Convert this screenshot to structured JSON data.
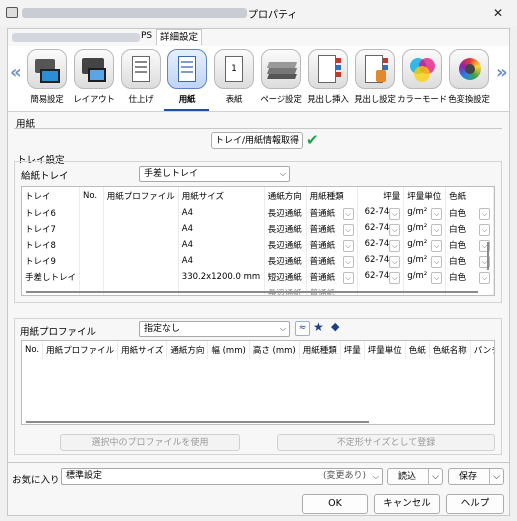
{
  "window": {
    "title": "プロパティ",
    "controls": {
      "close": "✕"
    }
  },
  "tabs": [
    {
      "label": "PS"
    },
    {
      "label": "詳細設定"
    }
  ],
  "categories": [
    {
      "label": "簡易設定"
    },
    {
      "label": "レイアウト"
    },
    {
      "label": "仕上げ"
    },
    {
      "label": "用紙",
      "selected": true
    },
    {
      "label": "表紙"
    },
    {
      "label": "ページ設定"
    },
    {
      "label": "見出し挿入"
    },
    {
      "label": "見出し設定"
    },
    {
      "label": "カラーモード"
    },
    {
      "label": "色変換設定"
    }
  ],
  "nav": {
    "prev": "«",
    "next": "»"
  },
  "paper": {
    "section_label": "用紙",
    "get_tray_info_button": "トレイ/用紙情報取得",
    "tray_settings_label": "トレイ設定",
    "feed_tray_label": "給紙トレイ",
    "feed_tray_value": "手差しトレイ"
  },
  "tray_table": {
    "headers": [
      "トレイ",
      "No.",
      "用紙プロファイル",
      "用紙サイズ",
      "通紙方向",
      "用紙種類",
      "坪量",
      "坪量単位",
      "色紙"
    ],
    "rows": [
      [
        "トレイ6",
        "",
        "",
        "A4",
        "長辺通紙",
        "普通紙",
        "62-74",
        "g/m²",
        "白色"
      ],
      [
        "トレイ7",
        "",
        "",
        "A4",
        "長辺通紙",
        "普通紙",
        "62-74",
        "g/m²",
        "白色"
      ],
      [
        "トレイ8",
        "",
        "",
        "A4",
        "長辺通紙",
        "普通紙",
        "62-74",
        "g/m²",
        "白色"
      ],
      [
        "トレイ9",
        "",
        "",
        "A4",
        "長辺通紙",
        "普通紙",
        "62-74",
        "g/m²",
        "白色"
      ],
      [
        "手差しトレイ",
        "",
        "",
        "330.2x1200.0 mm",
        "短辺通紙",
        "普通紙",
        "62-74",
        "g/m²",
        "白色"
      ],
      [
        "",
        "",
        "",
        "",
        "長辺通紙",
        "普通紙",
        "",
        "",
        ""
      ]
    ]
  },
  "profile": {
    "label": "用紙プロファイル",
    "value": "指定なし",
    "headers": [
      "No.",
      "用紙プロファイル",
      "用紙サイズ",
      "通紙方向",
      "幅 (mm)",
      "高さ (mm)",
      "用紙種類",
      "坪量",
      "坪量単位",
      "色紙",
      "色紙名称",
      "パンチ穴"
    ],
    "use_selected_button": "選択中のプロファイルを使用",
    "register_custom_button": "不定形サイズとして登録"
  },
  "favorites": {
    "label": "お気に入り",
    "value": "標準設定",
    "changed": "(変更あり)",
    "load_button": "読込",
    "save_button": "保存"
  },
  "footer": {
    "ok": "OK",
    "cancel": "キャンセル",
    "help": "ヘルプ"
  }
}
